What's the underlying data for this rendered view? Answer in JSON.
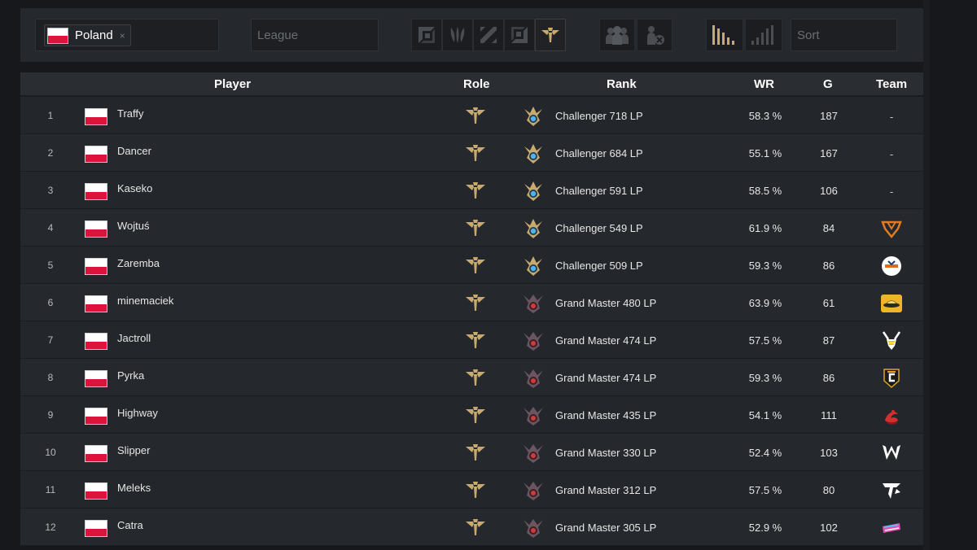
{
  "filters": {
    "country": {
      "label": "Poland",
      "remove": "×",
      "flag": "poland-flag"
    },
    "league": {
      "placeholder": "League"
    },
    "sort": {
      "placeholder": "Sort"
    },
    "role_buttons": [
      "top-lane-icon",
      "jungle-icon",
      "mid-lane-icon",
      "bottom-lane-icon",
      "support-icon"
    ],
    "active_role": "support-icon",
    "team_buttons": [
      "with-team-icon",
      "without-team-icon"
    ],
    "sort_buttons": [
      "sort-descending-icon",
      "sort-ascending-icon"
    ]
  },
  "table": {
    "headers": {
      "player": "Player",
      "role": "Role",
      "rank": "Rank",
      "wr": "WR",
      "g": "G",
      "team": "Team"
    },
    "rows": [
      {
        "num": "1",
        "name": "Traffy",
        "rank": "Challenger 718 LP",
        "tier": "challenger",
        "wr": "58.3 %",
        "g": "187",
        "team": "-"
      },
      {
        "num": "2",
        "name": "Dancer",
        "rank": "Challenger 684 LP",
        "tier": "challenger",
        "wr": "55.1 %",
        "g": "167",
        "team": "-"
      },
      {
        "num": "3",
        "name": "Kaseko",
        "rank": "Challenger 591 LP",
        "tier": "challenger",
        "wr": "58.5 %",
        "g": "106",
        "team": "-"
      },
      {
        "num": "4",
        "name": "Wojtuś",
        "rank": "Challenger 549 LP",
        "tier": "challenger",
        "wr": "61.9 %",
        "g": "84",
        "team": "team-logo-orange-diamond"
      },
      {
        "num": "5",
        "name": "Zaremba",
        "rank": "Challenger 509 LP",
        "tier": "challenger",
        "wr": "59.3 %",
        "g": "86",
        "team": "team-logo-montpellier"
      },
      {
        "num": "6",
        "name": "minemaciek",
        "rank": "Grand Master 480 LP",
        "tier": "grandmaster",
        "wr": "63.9 %",
        "g": "61",
        "team": "team-logo-yellow-hat"
      },
      {
        "num": "7",
        "name": "Jactroll",
        "rank": "Grand Master 474 LP",
        "tier": "grandmaster",
        "wr": "57.5 %",
        "g": "87",
        "team": "team-logo-vitality-bee"
      },
      {
        "num": "8",
        "name": "Pyrka",
        "rank": "Grand Master 474 LP",
        "tier": "grandmaster",
        "wr": "59.3 %",
        "g": "86",
        "team": "team-logo-crest-c"
      },
      {
        "num": "9",
        "name": "Highway",
        "rank": "Grand Master 435 LP",
        "tier": "grandmaster",
        "wr": "54.1 %",
        "g": "111",
        "team": "team-logo-red-dragon"
      },
      {
        "num": "10",
        "name": "Slipper",
        "rank": "Grand Master 330 LP",
        "tier": "grandmaster",
        "wr": "52.4 %",
        "g": "103",
        "team": "team-logo-white-w"
      },
      {
        "num": "11",
        "name": "Meleks",
        "rank": "Grand Master 312 LP",
        "tier": "grandmaster",
        "wr": "57.5 %",
        "g": "80",
        "team": "team-logo-white-arrow"
      },
      {
        "num": "12",
        "name": "Catra",
        "rank": "Grand Master 305 LP",
        "tier": "grandmaster",
        "wr": "52.9 %",
        "g": "102",
        "team": "team-logo-pink-sticker"
      }
    ]
  },
  "colors": {
    "gold": "#c8aa6e",
    "dim_icon": "#4a4d52",
    "challenger_gem": "#4fb3e8",
    "grandmaster_gem": "#d23a3a",
    "row_bg": "#25282c",
    "header_bg": "#2a2d31"
  }
}
